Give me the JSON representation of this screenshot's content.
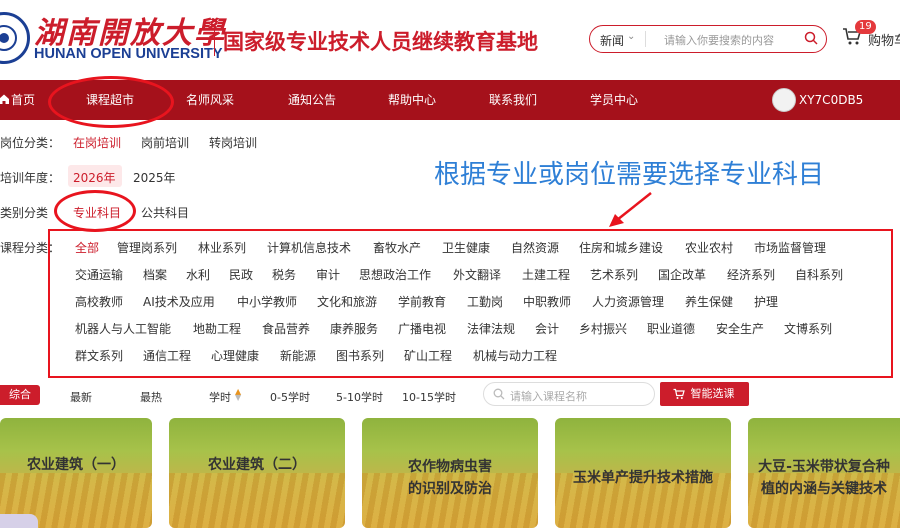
{
  "header": {
    "logo_cn": "湖南開放大學",
    "logo_en": "HUNAN OPEN UNIVERSITY",
    "site_title": "国家级专业技术人员继续教育基地",
    "search": {
      "scope": "新闻",
      "placeholder": "请输入你要搜索的内容"
    },
    "cart": {
      "count": "19",
      "label": "购物车"
    }
  },
  "nav": {
    "items": [
      "首页",
      "课程超市",
      "名师风采",
      "通知公告",
      "帮助中心",
      "联系我们",
      "学员中心"
    ],
    "username": "XY7C0DB5"
  },
  "filters": {
    "post": {
      "label": "岗位分类：",
      "options": [
        "在岗培训",
        "岗前培训",
        "转岗培训"
      ]
    },
    "year": {
      "label": "培训年度：",
      "options": [
        "2026年",
        "2025年"
      ]
    },
    "type": {
      "label": "类别分类",
      "options": [
        "专业科目",
        "公共科目"
      ]
    },
    "course": {
      "label": "课程分类：",
      "rows": [
        [
          "全部",
          "管理岗系列",
          "林业系列",
          "计算机信息技术",
          "畜牧水产",
          "卫生健康",
          "自然资源",
          "住房和城乡建设",
          "农业农村",
          "市场监督管理"
        ],
        [
          "交通运输",
          "档案",
          "水利",
          "民政",
          "税务",
          "审计",
          "思想政治工作",
          "外文翻译",
          "土建工程",
          "艺术系列",
          "国企改革",
          "经济系列",
          "自科系列"
        ],
        [
          "高校教师",
          "AI技术及应用",
          "中小学教师",
          "文化和旅游",
          "学前教育",
          "工勤岗",
          "中职教师",
          "人力资源管理",
          "养生保健",
          "护理"
        ],
        [
          "机器人与人工智能",
          "地勘工程",
          "食品营养",
          "康养服务",
          "广播电视",
          "法律法规",
          "会计",
          "乡村振兴",
          "职业道德",
          "安全生产",
          "文博系列"
        ],
        [
          "群文系列",
          "通信工程",
          "心理健康",
          "新能源",
          "图书系列",
          "矿山工程",
          "机械与动力工程"
        ]
      ]
    }
  },
  "annotation": "根据专业或岗位需要选择专业科目",
  "sortbar": {
    "items": [
      "综合",
      "最新",
      "最热",
      "学时",
      "0-5学时",
      "5-10学时",
      "10-15学时"
    ],
    "search_placeholder": "请输入课程名称",
    "smart_button": "智能选课"
  },
  "courses": [
    {
      "title": "农业建筑（一）"
    },
    {
      "title": "农业建筑（二）"
    },
    {
      "title": "农作物病虫害的识别及防治"
    },
    {
      "title": "玉米单产提升技术措施"
    },
    {
      "title": "大豆-玉米带状复合种植的内涵与关键技术"
    }
  ],
  "colors": {
    "brand_red": "#cc1d2b",
    "nav_bg": "#a5111b",
    "annotation_red": "#e8141e",
    "annotation_blue": "#2e7fd6",
    "logo_blue": "#1b3f94"
  },
  "icons": {
    "search": "search-icon",
    "cart": "cart-icon",
    "home": "home-icon",
    "logo": "university-emblem-icon"
  }
}
